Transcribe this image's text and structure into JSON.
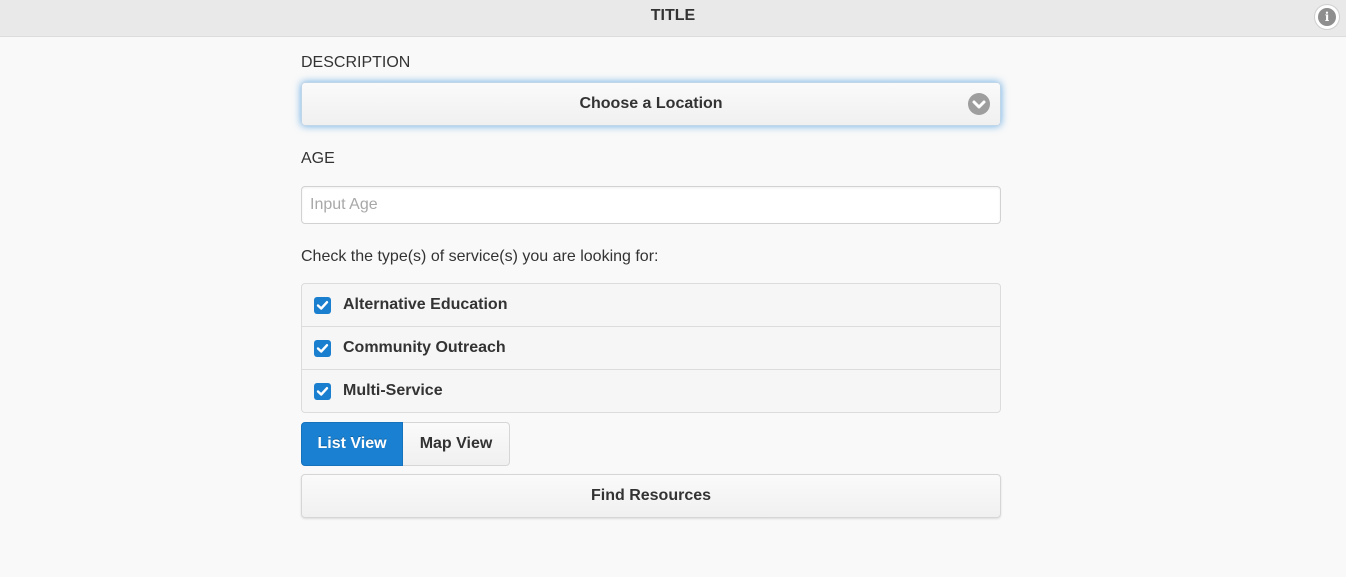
{
  "header": {
    "title": "TITLE",
    "info_icon": "info-icon"
  },
  "form": {
    "description_label": "DESCRIPTION",
    "location_select": {
      "value": "Choose a Location",
      "icon": "chevron-down-icon"
    },
    "age_label": "AGE",
    "age_input": {
      "value": "",
      "placeholder": "Input Age"
    },
    "services_prompt": "Check the type(s) of service(s) you are looking for:",
    "services": [
      {
        "label": "Alternative Education",
        "checked": true
      },
      {
        "label": "Community Outreach",
        "checked": true
      },
      {
        "label": "Multi-Service",
        "checked": true
      }
    ],
    "view_toggle": {
      "options": [
        "List View",
        "Map View"
      ],
      "selected": "List View"
    },
    "submit_label": "Find Resources"
  },
  "colors": {
    "accent": "#1a80d1",
    "header_bg": "#e9e9e9",
    "page_bg": "#f9f9f9"
  }
}
